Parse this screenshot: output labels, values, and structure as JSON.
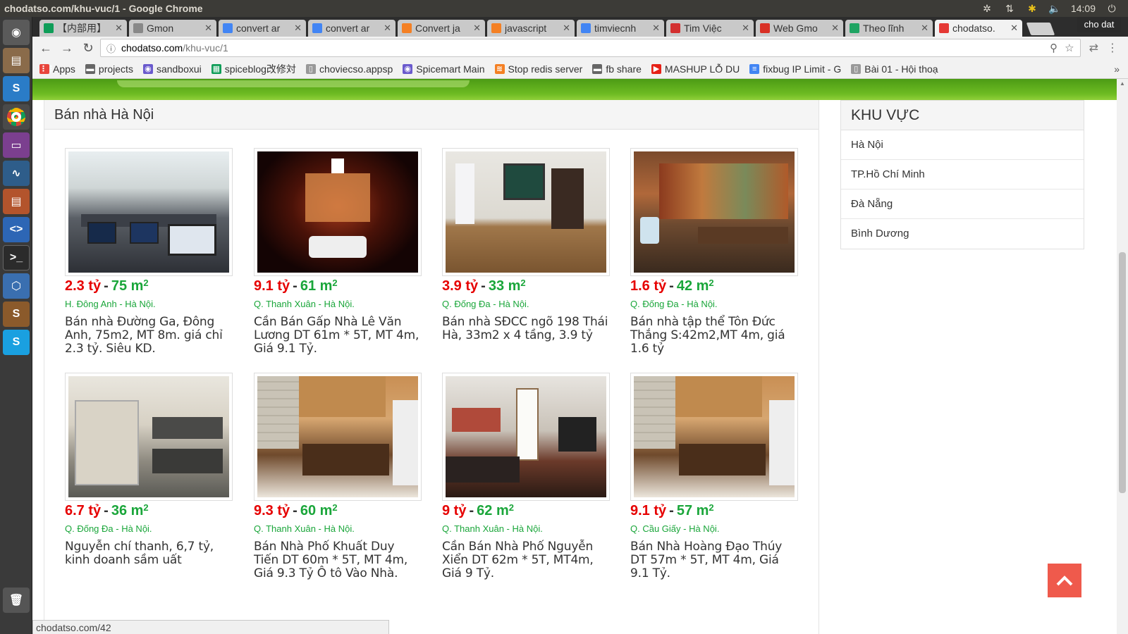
{
  "os": {
    "window_title": "chodatso.com/khu-vuc/1 - Google Chrome",
    "clock": "14:09",
    "profile": "cho dat"
  },
  "tabs": [
    {
      "label": "【内部用】",
      "icon": "sheets-icon",
      "color": "#0f9d58"
    },
    {
      "label": "Gmon",
      "icon": "page-icon",
      "color": "#888888"
    },
    {
      "label": "convert ar",
      "icon": "google-icon",
      "color": "#4285f4"
    },
    {
      "label": "convert ar",
      "icon": "google-icon",
      "color": "#4285f4"
    },
    {
      "label": "Convert ja",
      "icon": "stackoverflow-icon",
      "color": "#f48024"
    },
    {
      "label": "javascript",
      "icon": "stackoverflow-icon",
      "color": "#f48024"
    },
    {
      "label": "timviecnh",
      "icon": "google-icon",
      "color": "#4285f4"
    },
    {
      "label": "Tim Việc",
      "icon": "timviec-icon",
      "color": "#d32f2f"
    },
    {
      "label": "Web Gmo",
      "icon": "gmail-icon",
      "color": "#d93025"
    },
    {
      "label": "Theo lĩnh",
      "icon": "drive-icon",
      "color": "#1fa463"
    },
    {
      "label": "chodatso.",
      "icon": "home-icon",
      "color": "#e53935",
      "active": true
    }
  ],
  "address": {
    "host": "chodatso.com",
    "path": "/khu-vuc/1"
  },
  "bookmarks": [
    {
      "label": "Apps",
      "icon": "apps-grid-icon"
    },
    {
      "label": "projects",
      "icon": "folder-icon"
    },
    {
      "label": "sandboxui",
      "icon": "sandbox-icon"
    },
    {
      "label": "spiceblog改修対",
      "icon": "sheets-icon"
    },
    {
      "label": "choviecso.appsp",
      "icon": "page-icon"
    },
    {
      "label": "Spicemart Main",
      "icon": "sandbox-icon"
    },
    {
      "label": "Stop redis server",
      "icon": "stackoverflow-icon"
    },
    {
      "label": "fb share",
      "icon": "folder-icon"
    },
    {
      "label": "MASHUP LỖ DU",
      "icon": "youtube-icon"
    },
    {
      "label": "fixbug IP Limit - G",
      "icon": "docs-icon"
    },
    {
      "label": "Bài 01 - Hội thoạ",
      "icon": "page-icon"
    }
  ],
  "bookmarks_more": "»",
  "main": {
    "heading": "Bán nhà Hà Nội",
    "listings": [
      {
        "price": "2.3 tỷ",
        "area": "75 m",
        "location": "H. Đông Anh - Hà Nội.",
        "title": "Bán nhà Đường Ga, Đông Anh, 75m2, MT 8m. giá chỉ 2.3 tỷ. Siêu KD.",
        "scene": "internet-cafe"
      },
      {
        "price": "9.1 tỷ",
        "area": "61 m",
        "location": "Q. Thanh Xuân - Hà Nội.",
        "title": "Cần Bán Gấp Nhà Lê Văn Lương DT 61m * 5T, MT 4m, Giá 9.1 Tỷ.",
        "scene": "night-house"
      },
      {
        "price": "3.9 tỷ",
        "area": "33 m",
        "location": "Q. Đống Đa - Hà Nội.",
        "title": "Bán nhà SĐCC ngõ 198 Thái Hà, 33m2 x 4 tầng, 3.9 tỷ",
        "scene": "study-room"
      },
      {
        "price": "1.6 tỷ",
        "area": "42 m",
        "location": "Q. Đống Đa - Hà Nội.",
        "title": "Bán nhà tập thể Tôn Đức Thắng S:42m2,MT 4m, giá 1.6 tỷ",
        "scene": "dining-mural"
      },
      {
        "price": "6.7 tỷ",
        "area": "36 m",
        "location": "Q. Đống Đa - Hà Nội.",
        "title": "Nguyễn chí thanh, 6,7 tỷ, kinh doanh sầm uất",
        "scene": "facade"
      },
      {
        "price": "9.3 tỷ",
        "area": "60 m",
        "location": "Q. Thanh Xuân - Hà Nội.",
        "title": "Bán Nhà Phố Khuất Duy Tiến DT 60m * 5T, MT 4m, Giá 9.3 Tỷ Ô tô Vào Nhà.",
        "scene": "kitchen"
      },
      {
        "price": "9 tỷ",
        "area": "62 m",
        "location": "Q. Thanh Xuân - Hà Nội.",
        "title": "Cần Bán Nhà Phố Nguyễn Xiển DT 62m * 5T, MT4m, Giá 9 Tỷ.",
        "scene": "living-room"
      },
      {
        "price": "9.1 tỷ",
        "area": "57 m",
        "location": "Q. Cầu Giấy - Hà Nội.",
        "title": "Bán Nhà Hoàng Đạo Thúy DT 57m * 5T, MT 4m, Giá 9.1 Tỷ.",
        "scene": "kitchen"
      }
    ],
    "area_sup": "2",
    "sep": "-"
  },
  "sidebar": {
    "heading": "KHU VỰC",
    "items": [
      {
        "label": "Hà Nội"
      },
      {
        "label": "TP.Hồ Chí Minh"
      },
      {
        "label": "Đà Nẵng"
      },
      {
        "label": "Bình Dương"
      }
    ]
  },
  "status_url": "chodatso.com/42",
  "colors": {
    "price": "#e60000",
    "area": "#1aa63a",
    "to_top": "#ef5a4c",
    "banner": "#5aa81b"
  }
}
